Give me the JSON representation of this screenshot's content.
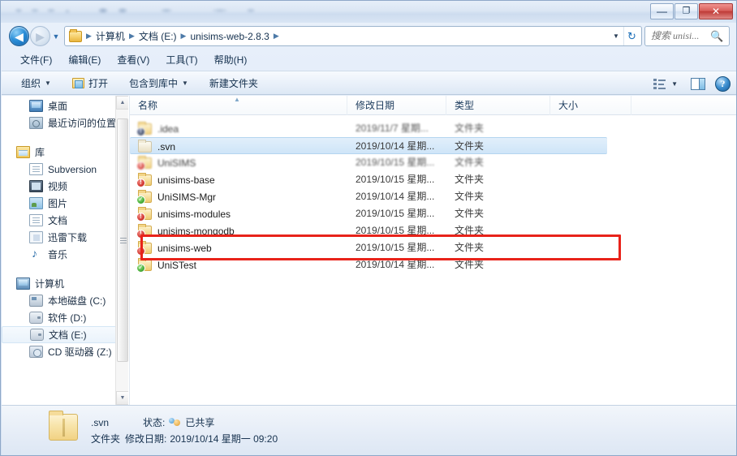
{
  "window": {
    "controls": {
      "minimize": "—",
      "maximize": "❐",
      "close": "✕"
    }
  },
  "address": {
    "back_label": "◀",
    "forward_label": "▶",
    "history_caret": "▼",
    "dropdown_caret": "▼",
    "refresh_icon": "↻",
    "crumbs": [
      "计算机",
      "文档 (E:)",
      "unisims-web-2.8.3"
    ],
    "separator": "▶"
  },
  "search": {
    "placeholder": "搜索 unisi...",
    "icon": "🔍"
  },
  "menubar": {
    "items": [
      "文件(F)",
      "编辑(E)",
      "查看(V)",
      "工具(T)",
      "帮助(H)"
    ]
  },
  "toolbar": {
    "organize": "组织",
    "open": "打开",
    "include_in_library": "包含到库中",
    "new_folder": "新建文件夹",
    "caret": "▼"
  },
  "navpane": {
    "favorites": [
      {
        "label": "桌面",
        "icon": "desktop-icon"
      },
      {
        "label": "最近访问的位置",
        "icon": "recent-places-icon"
      }
    ],
    "library_root": {
      "label": "库",
      "icon": "library-icon"
    },
    "libraries": [
      {
        "label": "Subversion",
        "icon": "document-icon"
      },
      {
        "label": "视频",
        "icon": "video-icon"
      },
      {
        "label": "图片",
        "icon": "picture-icon"
      },
      {
        "label": "文档",
        "icon": "document-icon"
      },
      {
        "label": "迅雷下载",
        "icon": "download-icon"
      },
      {
        "label": "音乐",
        "icon": "music-icon"
      }
    ],
    "computer_root": {
      "label": "计算机",
      "icon": "computer-icon"
    },
    "drives": [
      {
        "label": "本地磁盘 (C:)",
        "icon": "harddisk-icon",
        "selected": false
      },
      {
        "label": "软件 (D:)",
        "icon": "drive-icon",
        "selected": false
      },
      {
        "label": "文档 (E:)",
        "icon": "drive-icon",
        "selected": true
      },
      {
        "label": "CD 驱动器 (Z:)",
        "icon": "cd-drive-icon",
        "selected": false
      }
    ],
    "scroll_up": "▲",
    "scroll_down": "▼"
  },
  "filelist": {
    "columns": [
      "名称",
      "修改日期",
      "类型",
      "大小"
    ],
    "sort_indicator": "▲",
    "rows": [
      {
        "name": ".idea",
        "date": "2019/11/7 星期...",
        "type": "文件夹",
        "badge": "dark",
        "folder": "colored",
        "selected": false,
        "blurred": true
      },
      {
        "name": ".svn",
        "date": "2019/10/14 星期...",
        "type": "文件夹",
        "badge": "none",
        "folder": "plain",
        "selected": true,
        "blurred": false
      },
      {
        "name": "UniSIMS",
        "date": "2019/10/15 星期...",
        "type": "文件夹",
        "badge": "red",
        "folder": "colored",
        "selected": false,
        "blurred": true
      },
      {
        "name": "unisims-base",
        "date": "2019/10/15 星期...",
        "type": "文件夹",
        "badge": "red",
        "folder": "colored",
        "selected": false,
        "blurred": false
      },
      {
        "name": "UniSIMS-Mgr",
        "date": "2019/10/14 星期...",
        "type": "文件夹",
        "badge": "green",
        "folder": "colored",
        "selected": false,
        "blurred": false
      },
      {
        "name": "unisims-modules",
        "date": "2019/10/15 星期...",
        "type": "文件夹",
        "badge": "red",
        "folder": "colored",
        "selected": false,
        "blurred": false
      },
      {
        "name": "unisims-mongodb",
        "date": "2019/10/15 星期...",
        "type": "文件夹",
        "badge": "red",
        "folder": "colored",
        "selected": false,
        "blurred": false
      },
      {
        "name": "unisims-web",
        "date": "2019/10/15 星期...",
        "type": "文件夹",
        "badge": "red",
        "folder": "colored",
        "selected": false,
        "blurred": false
      },
      {
        "name": "UniSTest",
        "date": "2019/10/14 星期...",
        "type": "文件夹",
        "badge": "green",
        "folder": "colored",
        "selected": false,
        "blurred": false
      }
    ]
  },
  "annotation": {
    "color": "#e8231a",
    "target_row": ".svn"
  },
  "statusbar": {
    "name": ".svn",
    "state_label": "状态:",
    "state_value": "已共享",
    "type": "文件夹",
    "date_label": "修改日期:",
    "date_value": "2019/10/14 星期一 09:20"
  },
  "view_options": {
    "change_view": "change-view-icon",
    "preview_pane": "preview-pane-icon",
    "help": "?"
  }
}
